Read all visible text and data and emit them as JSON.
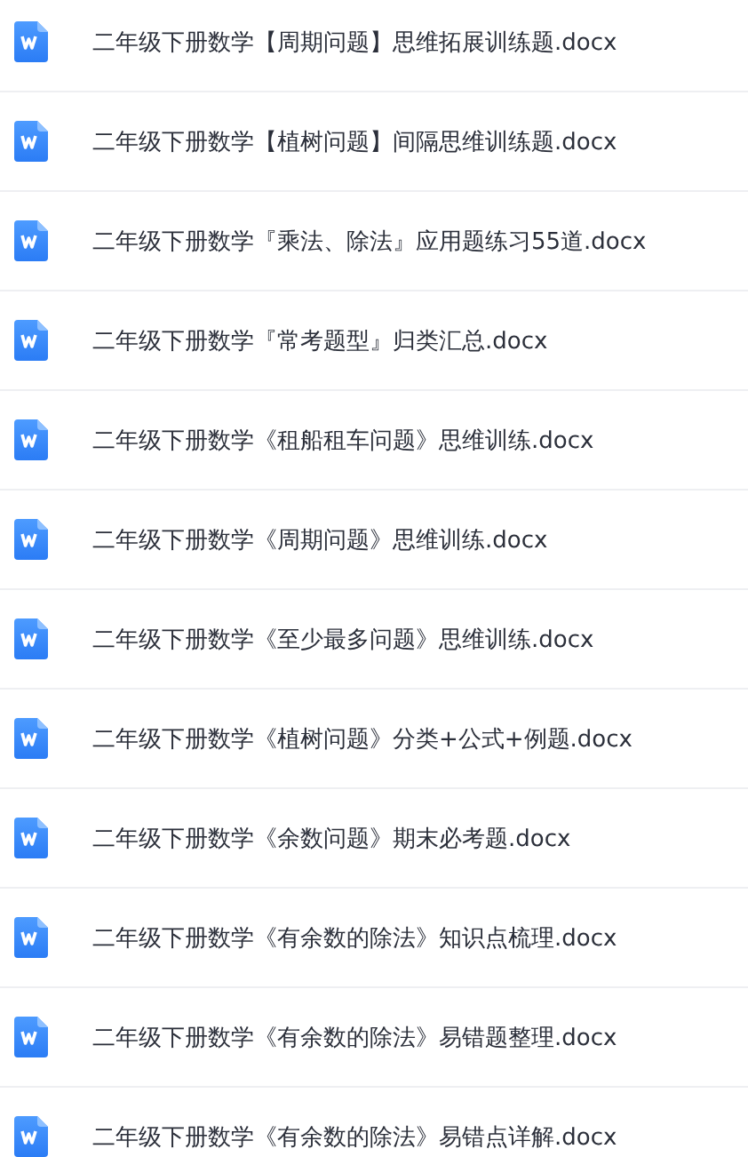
{
  "files": [
    {
      "name": "二年级下册数学【周期问题】思维拓展训练题.docx"
    },
    {
      "name": "二年级下册数学【植树问题】间隔思维训练题.docx"
    },
    {
      "name": "二年级下册数学『乘法、除法』应用题练习55道.docx"
    },
    {
      "name": "二年级下册数学『常考题型』归类汇总.docx"
    },
    {
      "name": "二年级下册数学《租船租车问题》思维训练.docx"
    },
    {
      "name": "二年级下册数学《周期问题》思维训练.docx"
    },
    {
      "name": "二年级下册数学《至少最多问题》思维训练.docx"
    },
    {
      "name": "二年级下册数学《植树问题》分类+公式+例题.docx"
    },
    {
      "name": "二年级下册数学《余数问题》期末必考题.docx"
    },
    {
      "name": "二年级下册数学《有余数的除法》知识点梳理.docx"
    },
    {
      "name": "二年级下册数学《有余数的除法》易错题整理.docx"
    },
    {
      "name": "二年级下册数学《有余数的除法》易错点详解.docx"
    }
  ]
}
